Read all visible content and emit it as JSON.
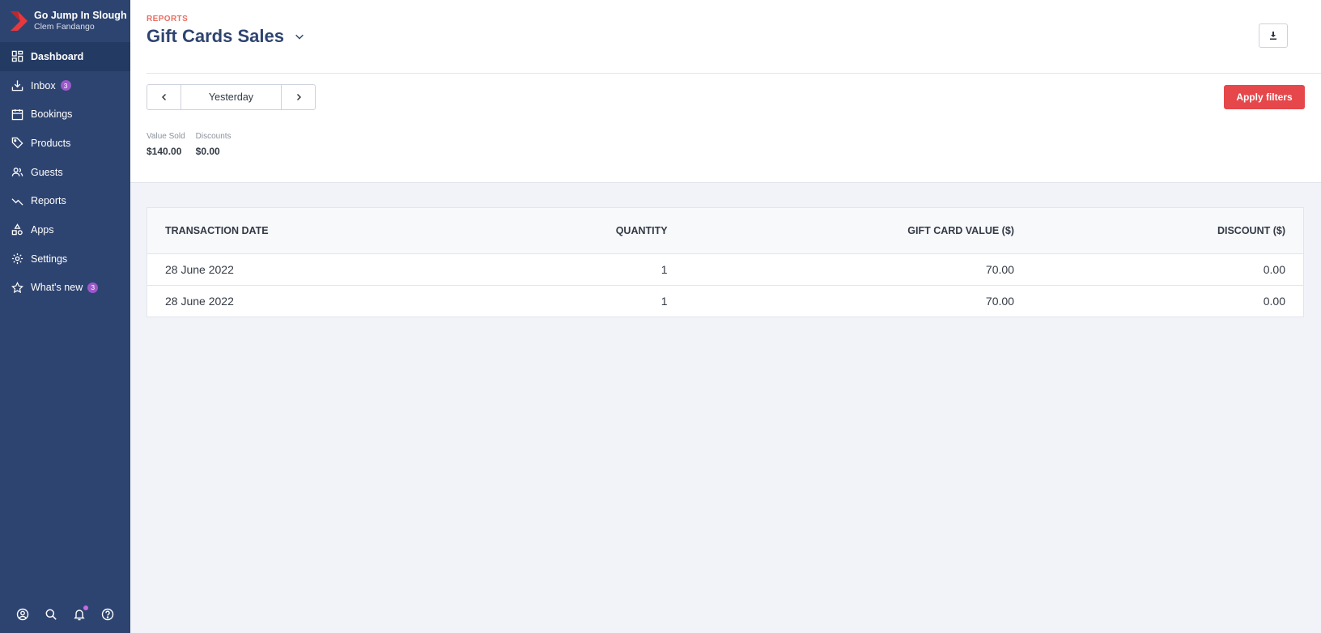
{
  "brand": {
    "name": "Go Jump In Slough",
    "user": "Clem Fandango"
  },
  "sidebar": {
    "items": [
      {
        "label": "Dashboard",
        "icon": "dashboard-icon",
        "active": true
      },
      {
        "label": "Inbox",
        "icon": "inbox-icon",
        "badge": "3"
      },
      {
        "label": "Bookings",
        "icon": "calendar-icon"
      },
      {
        "label": "Products",
        "icon": "tag-icon"
      },
      {
        "label": "Guests",
        "icon": "users-icon"
      },
      {
        "label": "Reports",
        "icon": "trend-icon"
      },
      {
        "label": "Apps",
        "icon": "apps-icon"
      },
      {
        "label": "Settings",
        "icon": "gear-icon"
      },
      {
        "label": "What's new",
        "icon": "star-icon",
        "badge": "3"
      }
    ],
    "bottom": [
      "account-icon",
      "search-icon",
      "bell-icon",
      "help-icon"
    ]
  },
  "header": {
    "breadcrumb": "REPORTS",
    "title": "Gift Cards Sales"
  },
  "filters": {
    "date_label": "Yesterday",
    "apply_label": "Apply filters"
  },
  "summary": [
    {
      "label": "Value Sold",
      "value": "$140.00"
    },
    {
      "label": "Discounts",
      "value": "$0.00"
    }
  ],
  "table": {
    "columns": [
      "TRANSACTION DATE",
      "QUANTITY",
      "GIFT CARD VALUE ($)",
      "DISCOUNT ($)"
    ],
    "rows": [
      [
        "28 June 2022",
        "1",
        "70.00",
        "0.00"
      ],
      [
        "28 June 2022",
        "1",
        "70.00",
        "0.00"
      ]
    ]
  },
  "colors": {
    "sidebar": "#2e4470",
    "accent": "#e5474b",
    "badge": "#9b59c9",
    "breadcrumb": "#ea6e62"
  }
}
